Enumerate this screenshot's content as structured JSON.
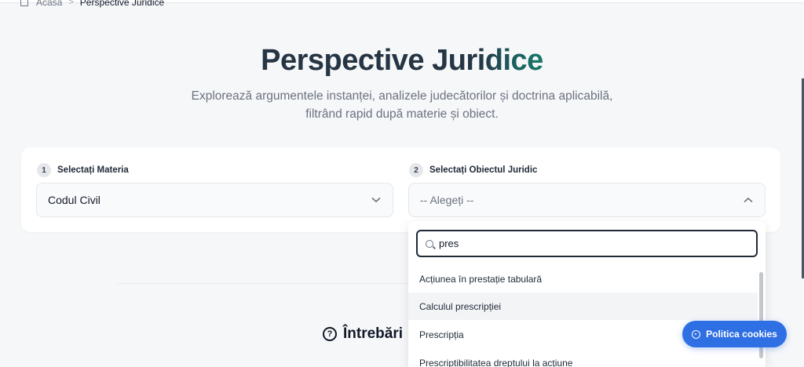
{
  "breadcrumb": {
    "home": "Acasa",
    "current": "Perspective Juridice"
  },
  "hero": {
    "title_part1": "Perspective Jur",
    "title_part2": "idice",
    "subtitle_line1": "Explorează argumentele instanței, analizele judecătorilor și doctrina aplicabilă,",
    "subtitle_line2": "filtrând rapid după materie și obiect."
  },
  "filters": {
    "materie": {
      "step": "1",
      "label": "Selectați Materia",
      "value": "Codul Civil"
    },
    "obiect": {
      "step": "2",
      "label": "Selectați Obiectul Juridic",
      "placeholder": "-- Alegeți --"
    }
  },
  "dropdown": {
    "search_value": "pres",
    "options": [
      "Acțiunea în prestație tabulară",
      "Calculul prescripției",
      "Prescripția",
      "Prescriptibilitatea dreptului la acțiune"
    ]
  },
  "faq": {
    "heading": "Întrebări"
  },
  "cookie": {
    "label": "Politica cookies"
  },
  "colors": {
    "accent": "#2f6fe4",
    "title_dark": "#263544",
    "title_teal": "#177a6a"
  }
}
